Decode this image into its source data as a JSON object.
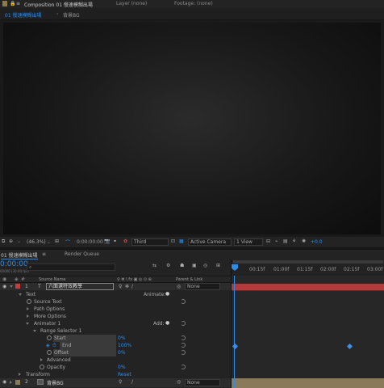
{
  "panels": {
    "composition_tab": "Composition 01 慢速模糊出場",
    "layer_tab": "Layer (none)",
    "footage_tab": "Footage: (none)",
    "subtab_active": "01 慢速模糊出場",
    "subtab_other": "背景BG"
  },
  "viewer_bar": {
    "zoom": "(46.3%)",
    "timecode": "0:00:00:00",
    "resolution": "Third",
    "camera": "Active Camera",
    "views": "1 View",
    "exposure": "+0.0"
  },
  "timeline": {
    "tab": "01 慢速模糊出場",
    "render_tab": "Render Queue",
    "current_time": "0:00:00",
    "frame_info": "00000 (30.00 fps)",
    "search_placeholder": "",
    "col_source_name": "Source Name",
    "col_switches": "♀ ✻ \\ fx ▣ ◎ ⊙ ⊕",
    "col_parent": "Parent & Link",
    "ruler_ticks": [
      "00:15f",
      "01:00f",
      "01:15f",
      "02:00f",
      "02:15f",
      "03:00f"
    ]
  },
  "layers": {
    "layer1_num": "1",
    "layer1_type": "T",
    "layer1_name": "六面選特效教學",
    "layer1_parent": "None",
    "text_group": "Text",
    "animate_label": "Animate:",
    "source_text": "Source Text",
    "path_options": "Path Options",
    "more_options": "More Options",
    "animator": "Animator 1",
    "add_label": "Add:",
    "range_selector": "Range Selector 1",
    "start_label": "Start",
    "start_value": "0%",
    "end_label": "End",
    "end_value": "100%",
    "offset_label": "Offset",
    "offset_value": "0%",
    "advanced": "Advanced",
    "opacity_label": "Opacity",
    "opacity_value": "0%",
    "transform": "Transform",
    "reset_label": "Reset",
    "layer2_num": "2",
    "layer2_name": "背景BG",
    "layer2_parent": "None"
  },
  "colors": {
    "accent_blue": "#2d8ceb",
    "layer1_bar": "#b23a3a",
    "layer2_bar": "#8a7a5a",
    "label_red": "#c83c3c",
    "label_tan": "#8a7a5a"
  }
}
